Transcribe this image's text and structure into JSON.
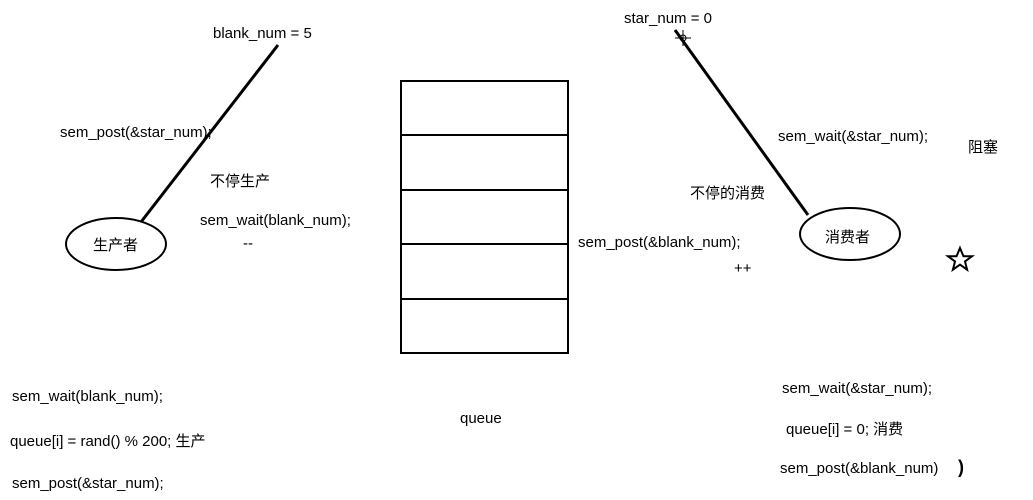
{
  "blank": {
    "label": "blank_num = ",
    "value": "5"
  },
  "star": {
    "label": "star_num = 0"
  },
  "producer": {
    "name": "生产者",
    "post": "sem_post(&star_num);",
    "loop": "不停生产",
    "wait": "sem_wait(blank_num);",
    "dec": "--",
    "code1": "sem_wait(blank_num);",
    "code2": "queue[i] = rand() % 200; 生产",
    "code3": "sem_post(&star_num);"
  },
  "consumer": {
    "name": "消费者",
    "wait": "sem_wait(&star_num);",
    "block": "阻塞",
    "loop": "不停的消费",
    "post": "sem_post(&blank_num);",
    "inc": "++",
    "code1": "sem_wait(&star_num);",
    "code2": "queue[i] = 0;   消费",
    "code3": "sem_post(&blank_num)"
  },
  "queue_label": "queue"
}
